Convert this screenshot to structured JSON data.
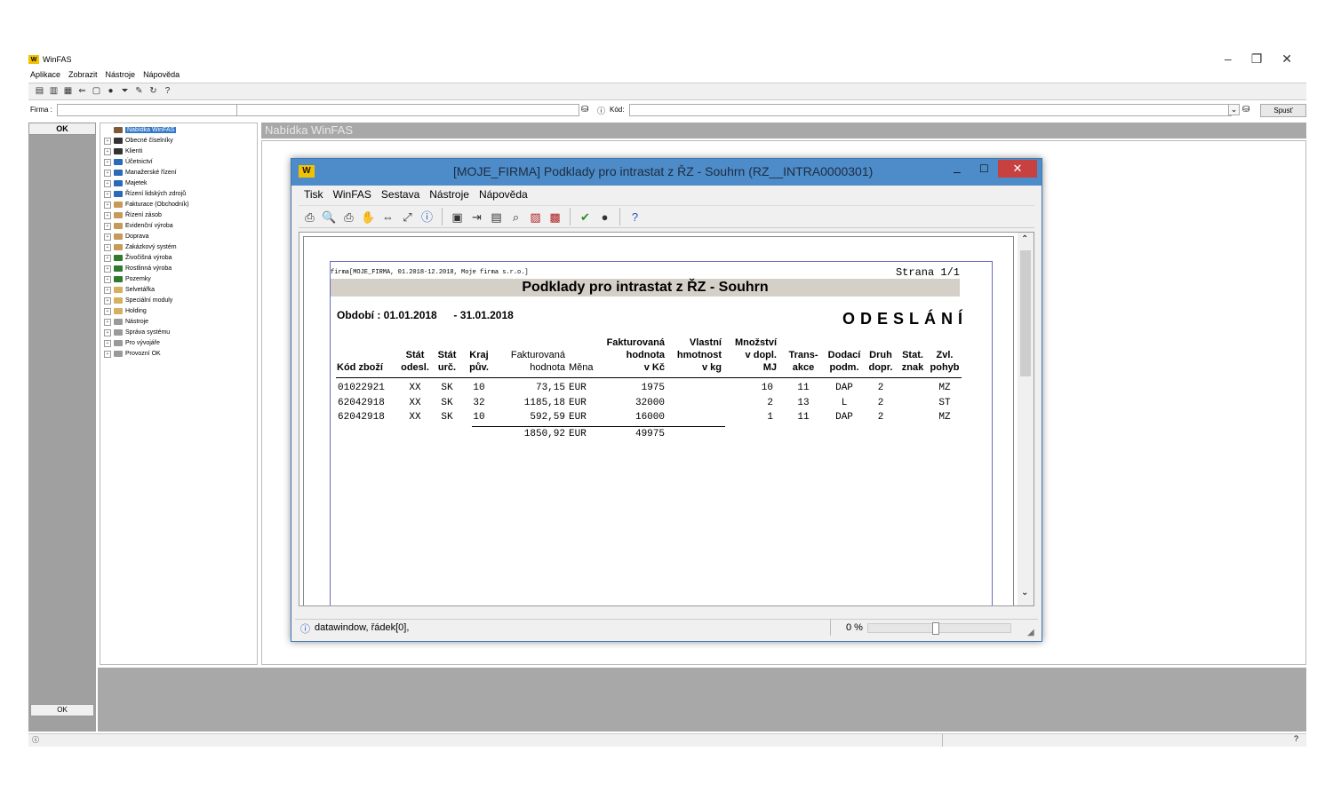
{
  "app": {
    "title": "WinFAS",
    "menu": [
      "Aplikace",
      "Zobrazit",
      "Nástroje",
      "Nápověda"
    ],
    "firm_label": "Firma :",
    "code_label": "Kód:",
    "run_label": "Spusť",
    "ok_label": "OK",
    "panel_title": "Nabídka WinFAS"
  },
  "tree": [
    {
      "label": "Nabídka WinFAS",
      "color": "#7a5c3a",
      "selected": true
    },
    {
      "label": "Obecné číselníky",
      "color": "#333333"
    },
    {
      "label": "Klienti",
      "color": "#333333"
    },
    {
      "label": "Účetnictví",
      "color": "#2a6ab8"
    },
    {
      "label": "Manažerské řízení",
      "color": "#2a6ab8"
    },
    {
      "label": "Majetek",
      "color": "#2a6ab8"
    },
    {
      "label": "Řízení lidských zdrojů",
      "color": "#2a6ab8"
    },
    {
      "label": "Fakturace (Obchodník)",
      "color": "#c89a5a"
    },
    {
      "label": "Řízení zásob",
      "color": "#c89a5a"
    },
    {
      "label": "Evidenční výroba",
      "color": "#c89a5a"
    },
    {
      "label": "Doprava",
      "color": "#c89a5a"
    },
    {
      "label": "Zakázkový systém",
      "color": "#c89a5a"
    },
    {
      "label": "Živočišná výroba",
      "color": "#2f7a2f"
    },
    {
      "label": "Rostlinná výroba",
      "color": "#2f7a2f"
    },
    {
      "label": "Pozemky",
      "color": "#2f7a2f"
    },
    {
      "label": "Selvetářka",
      "color": "#d4b060"
    },
    {
      "label": "Speciální moduly",
      "color": "#d4b060"
    },
    {
      "label": "Holding",
      "color": "#d4b060"
    },
    {
      "label": "Nástroje",
      "color": "#9a9a9a"
    },
    {
      "label": "Správa systému",
      "color": "#9a9a9a"
    },
    {
      "label": "Pro vývojáře",
      "color": "#9a9a9a"
    },
    {
      "label": "Provozní OK",
      "color": "#9a9a9a"
    }
  ],
  "dialog": {
    "title": "[MOJE_FIRMA] Podklady pro intrastat z ŘZ - Souhrn (RZ__INTRA0000301)",
    "menu": [
      "Tisk",
      "WinFAS",
      "Sestava",
      "Nástroje",
      "Nápověda"
    ],
    "status_text": "datawindow, řádek[0],",
    "progress_text": "0 %",
    "progress_value": 0
  },
  "report": {
    "firm_line": "firma[MOJE_FIRMA, 01.2018-12.2018, Moje firma s.r.o.]",
    "page": "Strana 1/1",
    "title": "Podklady pro intrastat z ŘZ - Souhrn",
    "period_label": "Období :",
    "period_from": "01.01.2018",
    "period_sep": "-",
    "period_to": "31.01.2018",
    "status": "ODESLÁNÍ",
    "headers": {
      "kod": [
        "Kód zboží"
      ],
      "stat_odesl": [
        "Stát",
        "odesl."
      ],
      "stat_urc": [
        "Stát",
        "urč."
      ],
      "kraj": [
        "Kraj",
        "pův."
      ],
      "fakt": [
        "Fakturovaná",
        "hodnota"
      ],
      "mena": [
        "Měna"
      ],
      "fakt_kc": [
        "Fakturovaná",
        "hodnota",
        "v Kč"
      ],
      "hmotnost": [
        "Vlastní",
        "hmotnost",
        "v kg"
      ],
      "mnozstvi": [
        "Množství",
        "v dopl.",
        "MJ"
      ],
      "trans": [
        "Trans-",
        "akce"
      ],
      "dodaci": [
        "Dodací",
        "podm."
      ],
      "druh": [
        "Druh",
        "dopr."
      ],
      "stat_znak": [
        "Stat.",
        "znak"
      ],
      "zvl": [
        "Zvl.",
        "pohyb"
      ]
    },
    "rows": [
      {
        "kod": "01022921",
        "odesl": "XX",
        "urc": "SK",
        "kraj": "10",
        "hodnota": "73,15",
        "mena": "EUR",
        "kc": "1975",
        "kg": "",
        "mj": "10",
        "trans": "11",
        "dodaci": "DAP",
        "druh": "2",
        "znak": "",
        "zvl": "MZ"
      },
      {
        "kod": "62042918",
        "odesl": "XX",
        "urc": "SK",
        "kraj": "32",
        "hodnota": "1185,18",
        "mena": "EUR",
        "kc": "32000",
        "kg": "",
        "mj": "2",
        "trans": "13",
        "dodaci": "L",
        "druh": "2",
        "znak": "",
        "zvl": "ST"
      },
      {
        "kod": "62042918",
        "odesl": "XX",
        "urc": "SK",
        "kraj": "10",
        "hodnota": "592,59",
        "mena": "EUR",
        "kc": "16000",
        "kg": "",
        "mj": "1",
        "trans": "11",
        "dodaci": "DAP",
        "druh": "2",
        "znak": "",
        "zvl": "MZ"
      }
    ],
    "totals": {
      "hodnota": "1850,92",
      "mena": "EUR",
      "kc": "49975"
    }
  }
}
